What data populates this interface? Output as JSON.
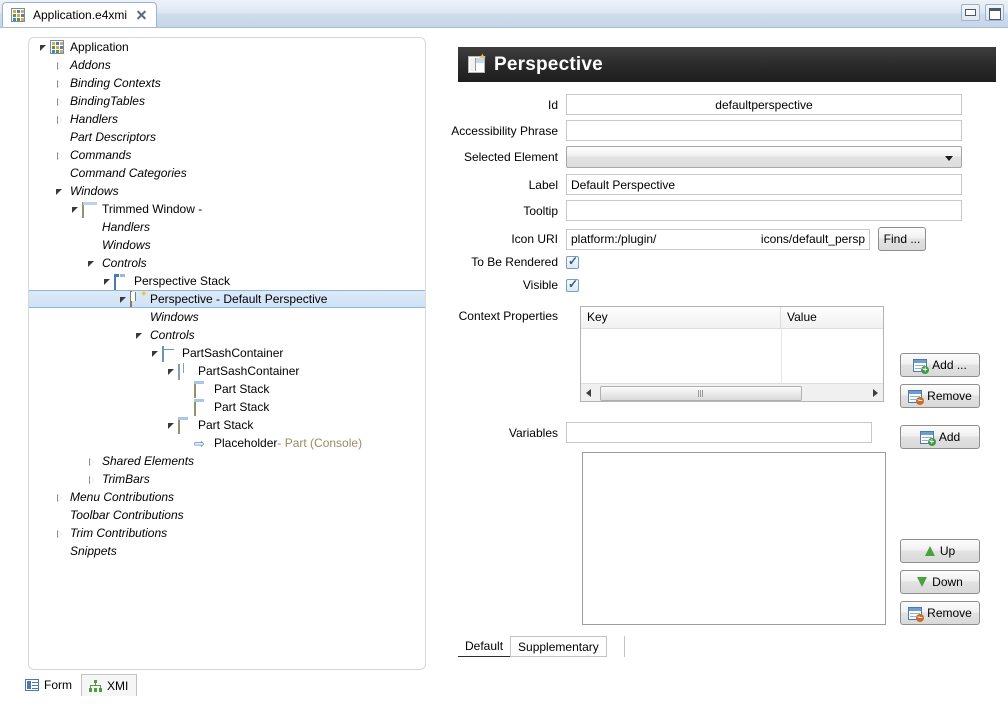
{
  "window": {
    "minimize_icon": "minimize-icon",
    "maximize_icon": "maximize-icon"
  },
  "editor_tab": {
    "label": "Application.e4xmi",
    "icon": "application-model-icon",
    "close_icon": "close-icon"
  },
  "tree": {
    "items": [
      {
        "label": "Application",
        "indent": 0,
        "twisty": "open",
        "icon": "application-icon",
        "italic": false,
        "selected": false
      },
      {
        "label": "Addons",
        "indent": 1,
        "twisty": "closed",
        "icon": "none",
        "italic": true,
        "selected": false
      },
      {
        "label": "Binding Contexts",
        "indent": 1,
        "twisty": "closed",
        "icon": "none",
        "italic": true,
        "selected": false
      },
      {
        "label": "BindingTables",
        "indent": 1,
        "twisty": "closed",
        "icon": "none",
        "italic": true,
        "selected": false
      },
      {
        "label": "Handlers",
        "indent": 1,
        "twisty": "closed",
        "icon": "none",
        "italic": true,
        "selected": false
      },
      {
        "label": "Part Descriptors",
        "indent": 1,
        "twisty": "none",
        "icon": "none",
        "italic": true,
        "selected": false
      },
      {
        "label": "Commands",
        "indent": 1,
        "twisty": "closed",
        "icon": "none",
        "italic": true,
        "selected": false
      },
      {
        "label": "Command Categories",
        "indent": 1,
        "twisty": "none",
        "icon": "none",
        "italic": true,
        "selected": false
      },
      {
        "label": "Windows",
        "indent": 1,
        "twisty": "open",
        "icon": "none",
        "italic": true,
        "selected": false
      },
      {
        "label": "Trimmed Window -",
        "indent": 2,
        "twisty": "open",
        "icon": "trimmed-window-icon",
        "italic": false,
        "selected": false
      },
      {
        "label": "Handlers",
        "indent": 3,
        "twisty": "none",
        "icon": "none",
        "italic": true,
        "selected": false
      },
      {
        "label": "Windows",
        "indent": 3,
        "twisty": "none",
        "icon": "none",
        "italic": true,
        "selected": false
      },
      {
        "label": "Controls",
        "indent": 3,
        "twisty": "open",
        "icon": "none",
        "italic": true,
        "selected": false
      },
      {
        "label": "Perspective Stack",
        "indent": 4,
        "twisty": "open",
        "icon": "perspective-stack-icon",
        "italic": false,
        "selected": false
      },
      {
        "label": "Perspective - Default Perspective",
        "indent": 5,
        "twisty": "open",
        "icon": "perspective-icon",
        "italic": false,
        "selected": true
      },
      {
        "label": "Windows",
        "indent": 6,
        "twisty": "none",
        "icon": "none",
        "italic": true,
        "selected": false
      },
      {
        "label": "Controls",
        "indent": 6,
        "twisty": "open",
        "icon": "none",
        "italic": true,
        "selected": false
      },
      {
        "label": "PartSashContainer",
        "indent": 7,
        "twisty": "open",
        "icon": "part-sash-container-horizontal-icon",
        "italic": false,
        "selected": false
      },
      {
        "label": "PartSashContainer",
        "indent": 8,
        "twisty": "open",
        "icon": "part-sash-container-vertical-icon",
        "italic": false,
        "selected": false
      },
      {
        "label": "Part Stack",
        "indent": 9,
        "twisty": "none",
        "icon": "part-stack-icon",
        "italic": false,
        "selected": false
      },
      {
        "label": "Part Stack",
        "indent": 9,
        "twisty": "none",
        "icon": "part-stack-icon",
        "italic": false,
        "selected": false
      },
      {
        "label": "Part Stack",
        "indent": 8,
        "twisty": "open",
        "icon": "part-stack-icon",
        "italic": false,
        "selected": false
      },
      {
        "label": "Placeholder",
        "sublabel": " - Part (Console)",
        "indent": 9,
        "twisty": "none",
        "icon": "placeholder-arrow-icon",
        "italic": false,
        "selected": false
      },
      {
        "label": "Shared Elements",
        "indent": 3,
        "twisty": "closed",
        "icon": "none",
        "italic": true,
        "selected": false
      },
      {
        "label": "TrimBars",
        "indent": 3,
        "twisty": "closed",
        "icon": "none",
        "italic": true,
        "selected": false
      },
      {
        "label": "Menu Contributions",
        "indent": 1,
        "twisty": "closed",
        "icon": "none",
        "italic": true,
        "selected": false
      },
      {
        "label": "Toolbar Contributions",
        "indent": 1,
        "twisty": "none",
        "icon": "none",
        "italic": true,
        "selected": false
      },
      {
        "label": "Trim Contributions",
        "indent": 1,
        "twisty": "closed",
        "icon": "none",
        "italic": true,
        "selected": false
      },
      {
        "label": "Snippets",
        "indent": 1,
        "twisty": "none",
        "icon": "none",
        "italic": true,
        "selected": false
      }
    ]
  },
  "editor_mode_tabs": {
    "items": [
      {
        "label": "Form",
        "icon": "form-icon",
        "active": true
      },
      {
        "label": "XMI",
        "icon": "xmi-tree-icon",
        "active": false
      }
    ]
  },
  "form": {
    "header": {
      "title": "Perspective",
      "icon": "perspective-icon"
    },
    "fields": {
      "id": {
        "label": "Id",
        "value": "defaultperspective"
      },
      "accessibility_phrase": {
        "label": "Accessibility Phrase",
        "value": ""
      },
      "selected_element": {
        "label": "Selected Element",
        "value": ""
      },
      "label_field": {
        "label": "Label",
        "value": "Default Perspective"
      },
      "tooltip": {
        "label": "Tooltip",
        "value": ""
      },
      "icon_uri": {
        "label": "Icon URI",
        "value_prefix": "platform:/plugin/",
        "value_suffix": "icons/default_persp",
        "find_button": "Find ..."
      },
      "to_be_rendered": {
        "label": "To Be Rendered",
        "checked": true
      },
      "visible": {
        "label": "Visible",
        "checked": true
      }
    },
    "context_properties": {
      "label": "Context Properties",
      "columns": [
        "Key",
        "Value"
      ],
      "rows": [],
      "add_button": "Add ...",
      "remove_button": "Remove"
    },
    "variables": {
      "label": "Variables",
      "input_value": "",
      "items": [],
      "add_button": "Add",
      "up_button": "Up",
      "down_button": "Down",
      "remove_button": "Remove"
    },
    "tabs": [
      {
        "label": "Default",
        "active": true
      },
      {
        "label": "Supplementary",
        "active": false
      }
    ]
  },
  "colors": {
    "header_bg": "#2b2b2b",
    "selection": "#cfe2f6",
    "accent_blue": "#4a7ab0",
    "green": "#4aa23f",
    "sublabel": "#9c8b65"
  }
}
